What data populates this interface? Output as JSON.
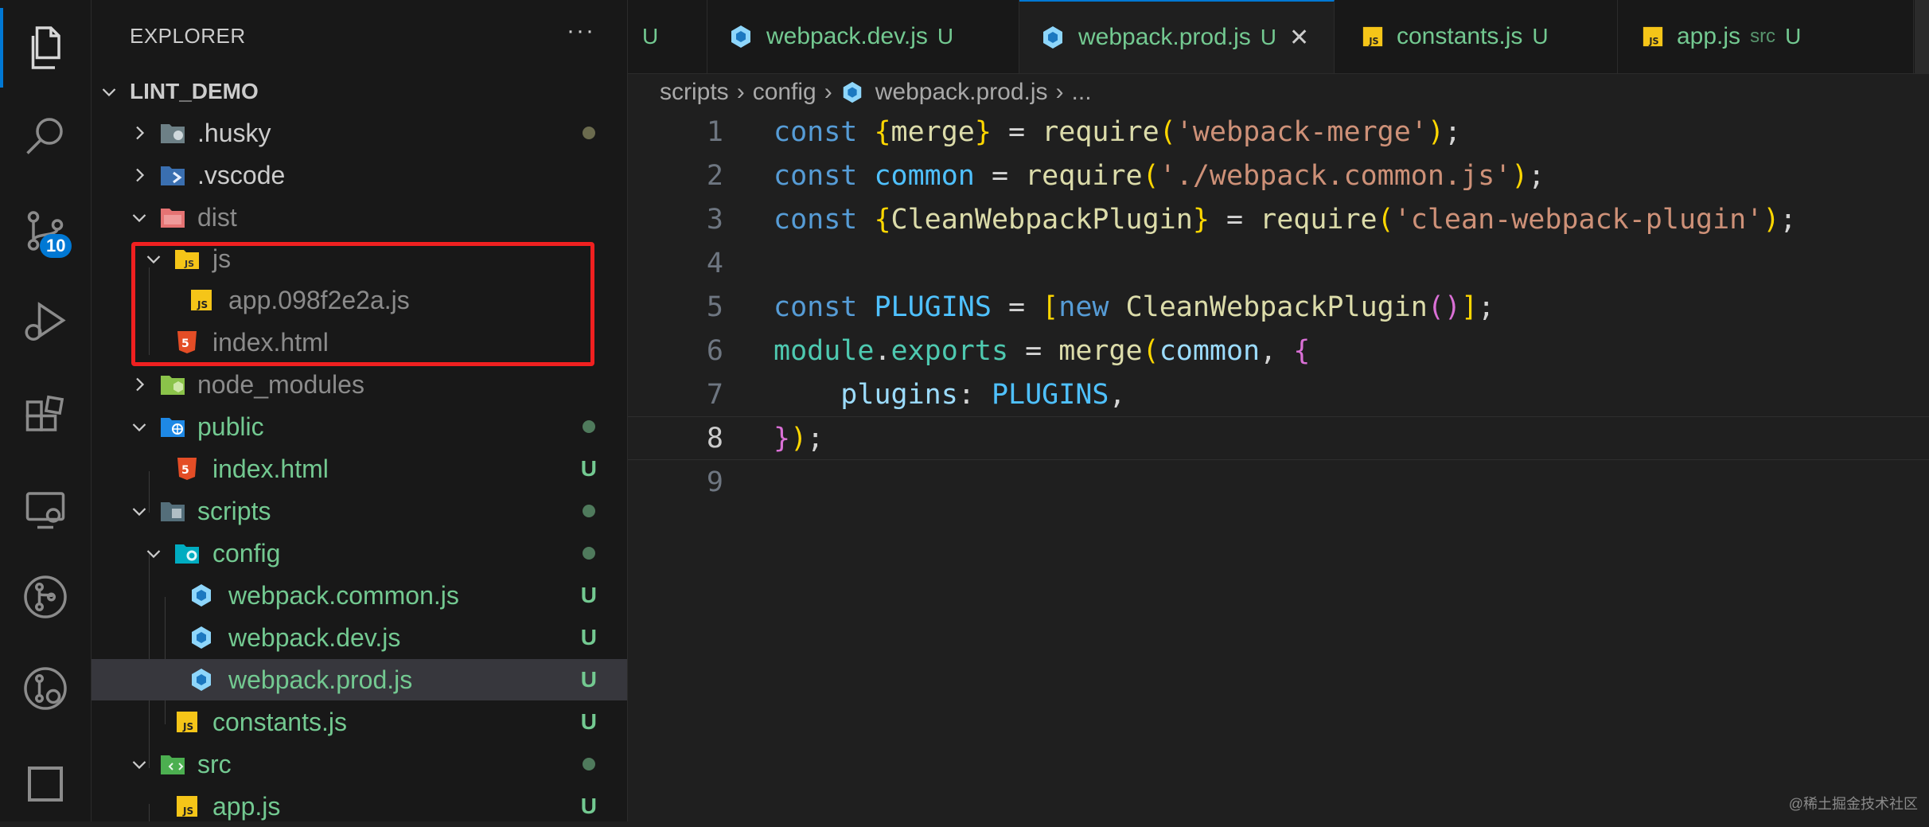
{
  "explorer": {
    "title": "EXPLORER",
    "more": "···",
    "root": "LINT_DEMO"
  },
  "activity": {
    "badge": "10",
    "icons": [
      "files-icon",
      "search-icon",
      "source-control-icon",
      "run-debug-icon",
      "extensions-icon",
      "remote-explorer-icon",
      "git-graph-icon",
      "gitlens-icon",
      "square-icon"
    ]
  },
  "tree": [
    {
      "name": ".husky",
      "color": "#cccccc"
    },
    {
      "name": ".vscode",
      "color": "#cccccc"
    },
    {
      "name": "dist",
      "color": "#8b8b8b"
    },
    {
      "name": "js",
      "color": "#8b8b8b"
    },
    {
      "name": "app.098f2e2a.js",
      "color": "#8b8b8b"
    },
    {
      "name": "index.html",
      "color": "#8b8b8b"
    },
    {
      "name": "node_modules",
      "color": "#8b8b8b"
    },
    {
      "name": "public",
      "color": "#73c991"
    },
    {
      "name": "index.html",
      "color": "#73c991",
      "status": "U"
    },
    {
      "name": "scripts",
      "color": "#73c991"
    },
    {
      "name": "config",
      "color": "#73c991"
    },
    {
      "name": "webpack.common.js",
      "color": "#73c991",
      "status": "U"
    },
    {
      "name": "webpack.dev.js",
      "color": "#73c991",
      "status": "U"
    },
    {
      "name": "webpack.prod.js",
      "color": "#73c991",
      "status": "U"
    },
    {
      "name": "constants.js",
      "color": "#73c991",
      "status": "U"
    },
    {
      "name": "src",
      "color": "#73c991"
    },
    {
      "name": "app.js",
      "color": "#73c991",
      "status": "U"
    }
  ],
  "tabs": [
    {
      "label": "",
      "status": "U"
    },
    {
      "label": "webpack.dev.js",
      "status": "U"
    },
    {
      "label": "webpack.prod.js",
      "status": "U",
      "close": "✕"
    },
    {
      "label": "constants.js",
      "status": "U"
    },
    {
      "label": "app.js",
      "hint": "src",
      "status": "U"
    }
  ],
  "breadcrumb": [
    "scripts",
    "config",
    "webpack.prod.js",
    "..."
  ],
  "code": {
    "line_numbers": [
      "1",
      "2",
      "3",
      "4",
      "5",
      "6",
      "7",
      "8",
      "9"
    ],
    "current_line": "8"
  },
  "watermark": "@稀土掘金技术社区",
  "colors": {
    "untracked": "#73c991",
    "accent": "#0078d4",
    "highlight_box": "#f02020"
  }
}
